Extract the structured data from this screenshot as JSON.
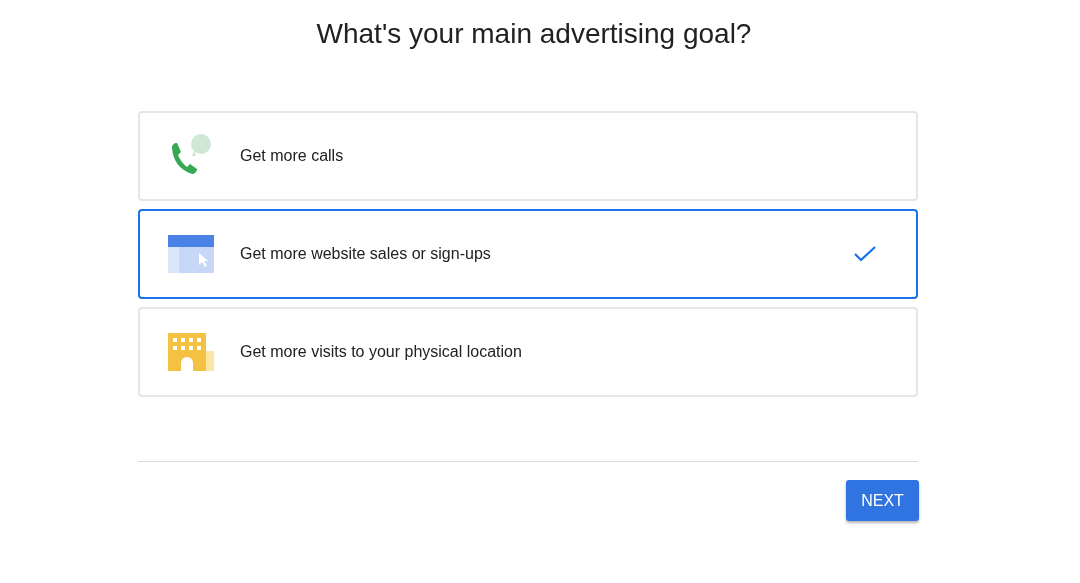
{
  "title": "What's your main advertising goal?",
  "options": [
    {
      "kind": "calls",
      "label": "Get more calls",
      "selected": false
    },
    {
      "kind": "website",
      "label": "Get more website sales or sign-ups",
      "selected": true
    },
    {
      "kind": "store",
      "label": "Get more visits to your physical location",
      "selected": false
    }
  ],
  "next_button": "NEXT"
}
